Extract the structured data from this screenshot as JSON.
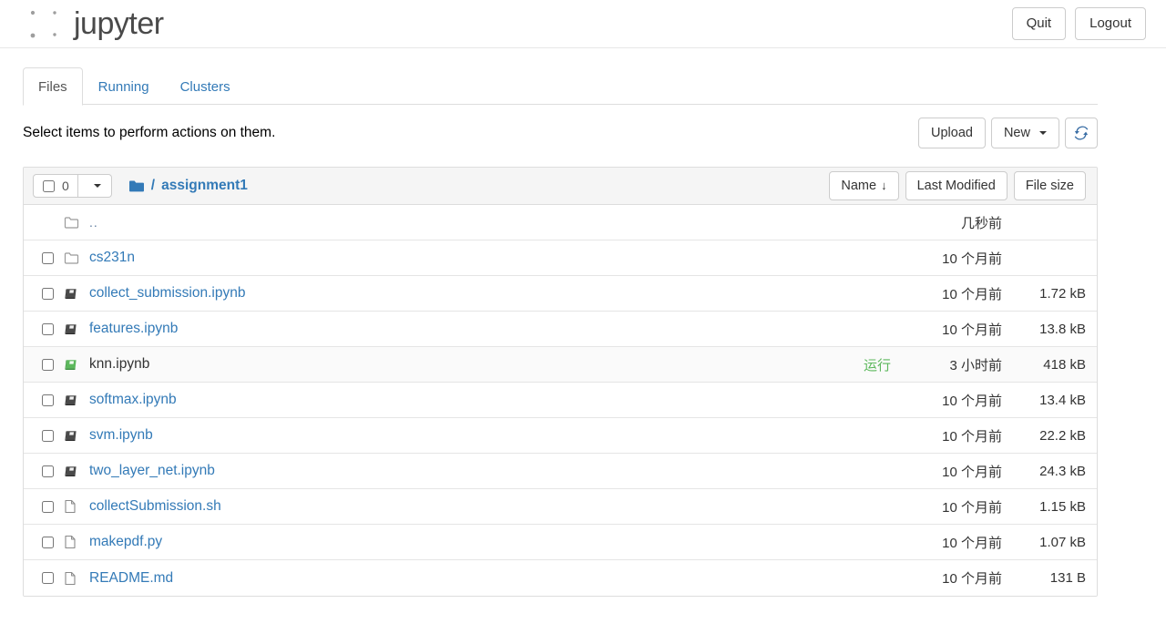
{
  "header": {
    "brand": "jupyter",
    "logo_icon": "jupyter-logo",
    "quit_label": "Quit",
    "logout_label": "Logout"
  },
  "tabs": [
    {
      "label": "Files",
      "active": true
    },
    {
      "label": "Running",
      "active": false
    },
    {
      "label": "Clusters",
      "active": false
    }
  ],
  "action_bar": {
    "hint": "Select items to perform actions on them.",
    "upload_label": "Upload",
    "new_label": "New",
    "new_caret_icon": "chevron-down-icon",
    "refresh_icon": "refresh-icon"
  },
  "list_header": {
    "selected_count": "0",
    "select_all_caret_icon": "chevron-down-icon",
    "folder_icon": "folder-icon",
    "path_separator": "/",
    "current_folder": "assignment1",
    "sort": {
      "name_label": "Name",
      "name_arrow": "↓",
      "modified_label": "Last Modified",
      "size_label": "File size"
    }
  },
  "colors": {
    "link_blue": "#337ab7",
    "running_green": "#5cb85c",
    "logo_orange": "#f37726",
    "header_bg": "#f5f5f5",
    "border": "#dddddd"
  },
  "rows": [
    {
      "name": "..",
      "icon": "folder-icon",
      "type": "parent",
      "has_checkbox": false,
      "status": "",
      "modified": "几秒前",
      "size": ""
    },
    {
      "name": "cs231n",
      "icon": "folder-icon",
      "type": "folder",
      "has_checkbox": true,
      "status": "",
      "modified": "10 个月前",
      "size": ""
    },
    {
      "name": "collect_submission.ipynb",
      "icon": "notebook-icon",
      "type": "notebook",
      "has_checkbox": true,
      "status": "",
      "modified": "10 个月前",
      "size": "1.72 kB"
    },
    {
      "name": "features.ipynb",
      "icon": "notebook-icon",
      "type": "notebook",
      "has_checkbox": true,
      "status": "",
      "modified": "10 个月前",
      "size": "13.8 kB"
    },
    {
      "name": "knn.ipynb",
      "icon": "notebook-running-icon",
      "type": "notebook-running",
      "has_checkbox": true,
      "status": "运行",
      "modified": "3 小时前",
      "size": "418 kB"
    },
    {
      "name": "softmax.ipynb",
      "icon": "notebook-icon",
      "type": "notebook",
      "has_checkbox": true,
      "status": "",
      "modified": "10 个月前",
      "size": "13.4 kB"
    },
    {
      "name": "svm.ipynb",
      "icon": "notebook-icon",
      "type": "notebook",
      "has_checkbox": true,
      "status": "",
      "modified": "10 个月前",
      "size": "22.2 kB"
    },
    {
      "name": "two_layer_net.ipynb",
      "icon": "notebook-icon",
      "type": "notebook",
      "has_checkbox": true,
      "status": "",
      "modified": "10 个月前",
      "size": "24.3 kB"
    },
    {
      "name": "collectSubmission.sh",
      "icon": "file-icon",
      "type": "file",
      "has_checkbox": true,
      "status": "",
      "modified": "10 个月前",
      "size": "1.15 kB"
    },
    {
      "name": "makepdf.py",
      "icon": "file-icon",
      "type": "file",
      "has_checkbox": true,
      "status": "",
      "modified": "10 个月前",
      "size": "1.07 kB"
    },
    {
      "name": "README.md",
      "icon": "file-icon",
      "type": "file",
      "has_checkbox": true,
      "status": "",
      "modified": "10 个月前",
      "size": "131 B"
    }
  ]
}
